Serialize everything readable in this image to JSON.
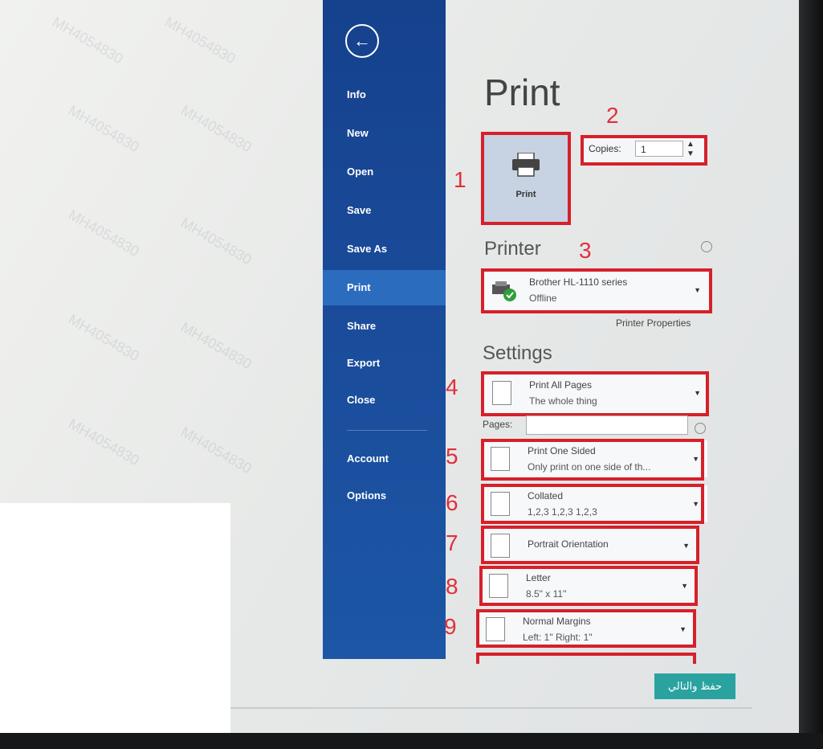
{
  "sidebar": {
    "back_glyph": "←",
    "items": [
      {
        "label": "Info"
      },
      {
        "label": "New"
      },
      {
        "label": "Open"
      },
      {
        "label": "Save"
      },
      {
        "label": "Save As"
      },
      {
        "label": "Print",
        "active": true
      },
      {
        "label": "Share"
      },
      {
        "label": "Export"
      },
      {
        "label": "Close"
      },
      {
        "label": "Account"
      },
      {
        "label": "Options"
      }
    ]
  },
  "main": {
    "title": "Print",
    "print_button_label": "Print",
    "copies_label": "Copies:",
    "copies_value": "1",
    "printer_heading": "Printer",
    "printer_name": "Brother HL-1110 series",
    "printer_status": "Offline",
    "printer_properties": "Printer Properties",
    "settings_heading": "Settings",
    "pages_label": "Pages:",
    "settings": [
      {
        "line1": "Print All Pages",
        "line2": "The whole thing"
      },
      {
        "line1": "Print One Sided",
        "line2": "Only print on one side of th..."
      },
      {
        "line1": "Collated",
        "line2": "1,2,3   1,2,3   1,2,3"
      },
      {
        "line1": "Portrait Orientation",
        "line2": ""
      },
      {
        "line1": "Letter",
        "line2": "8.5\" x 11\""
      },
      {
        "line1": "Normal Margins",
        "line2": "Left: 1\"   Right: 1\""
      }
    ]
  },
  "annotations": [
    "1",
    "2",
    "3",
    "4",
    "5",
    "6",
    "7",
    "8",
    "9"
  ],
  "footer": {
    "button_label": "حفظ والتالي"
  },
  "colors": {
    "sidebar": "#1a4c9b",
    "sidebar_active": "#2b6cbf",
    "annotation_red": "#d6202a",
    "footer_button": "#2aa3a0"
  }
}
